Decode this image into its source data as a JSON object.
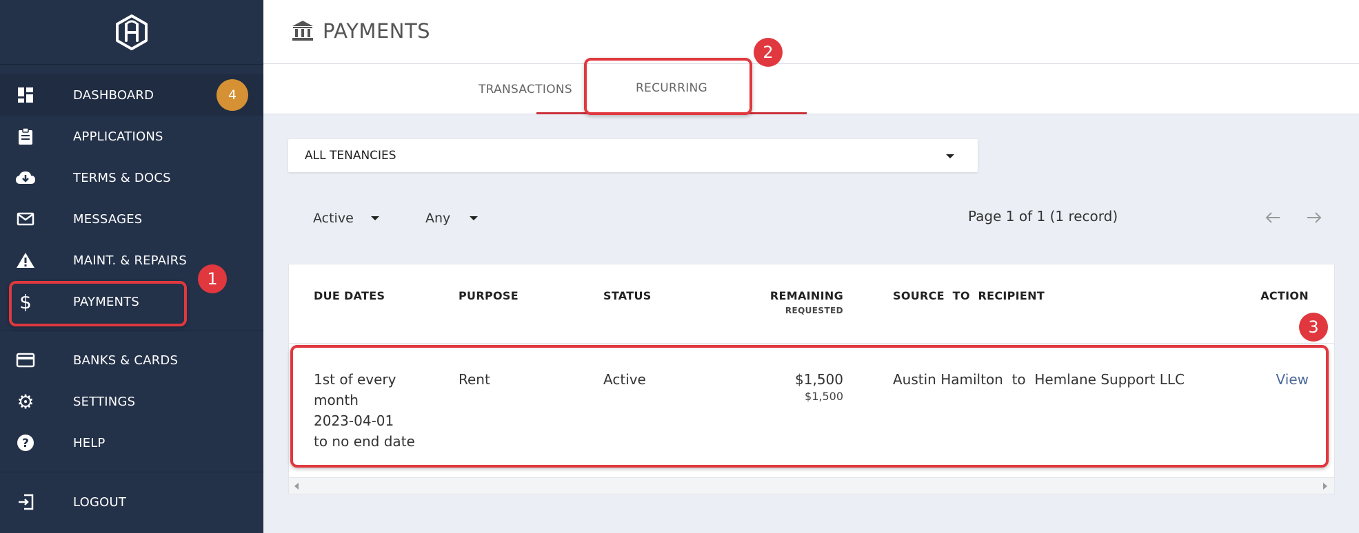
{
  "sidebar": {
    "items": [
      {
        "label": "DASHBOARD",
        "icon": "dashboard-icon",
        "badge": "4"
      },
      {
        "label": "APPLICATIONS",
        "icon": "clipboard-icon"
      },
      {
        "label": "TERMS & DOCS",
        "icon": "cloud-download-icon"
      },
      {
        "label": "MESSAGES",
        "icon": "mail-icon"
      },
      {
        "label": "MAINT. & REPAIRS",
        "icon": "warning-icon"
      },
      {
        "label": "PAYMENTS",
        "icon": "dollar-icon"
      },
      {
        "label": "BANKS & CARDS",
        "icon": "credit-card-icon"
      },
      {
        "label": "SETTINGS",
        "icon": "gear-icon"
      },
      {
        "label": "HELP",
        "icon": "help-icon"
      },
      {
        "label": "LOGOUT",
        "icon": "logout-icon"
      }
    ]
  },
  "header": {
    "title": "PAYMENTS",
    "icon": "bank-icon"
  },
  "tabs": [
    {
      "label": "TRANSACTIONS"
    },
    {
      "label": "RECURRING",
      "active": true
    }
  ],
  "tenancy": {
    "selected": "ALL TENANCIES"
  },
  "filters": {
    "status": "Active",
    "type": "Any"
  },
  "pager": {
    "text": "Page 1 of 1 (1 record)"
  },
  "table": {
    "columns": {
      "due_dates": "DUE DATES",
      "purpose": "PURPOSE",
      "status": "STATUS",
      "remaining": "REMAINING",
      "requested": "REQUESTED",
      "source_recipient": "SOURCE  TO  RECIPIENT",
      "action": "ACTION"
    },
    "rows": [
      {
        "due_line1": "1st of every",
        "due_line2": "month",
        "due_line3": "2023-04-01",
        "due_line4": "to no end date",
        "purpose": "Rent",
        "status": "Active",
        "remaining": "$1,500",
        "requested": "$1,500",
        "source_recipient": "Austin Hamilton  to  Hemlane Support LLC",
        "action": "View"
      }
    ]
  },
  "annotations": [
    "1",
    "2",
    "3"
  ],
  "colors": {
    "sidebar_bg": "#233149",
    "badge": "#d59133",
    "accent_red": "#e0383e",
    "tab_underline": "#c9303a",
    "link": "#4d6a9c"
  }
}
